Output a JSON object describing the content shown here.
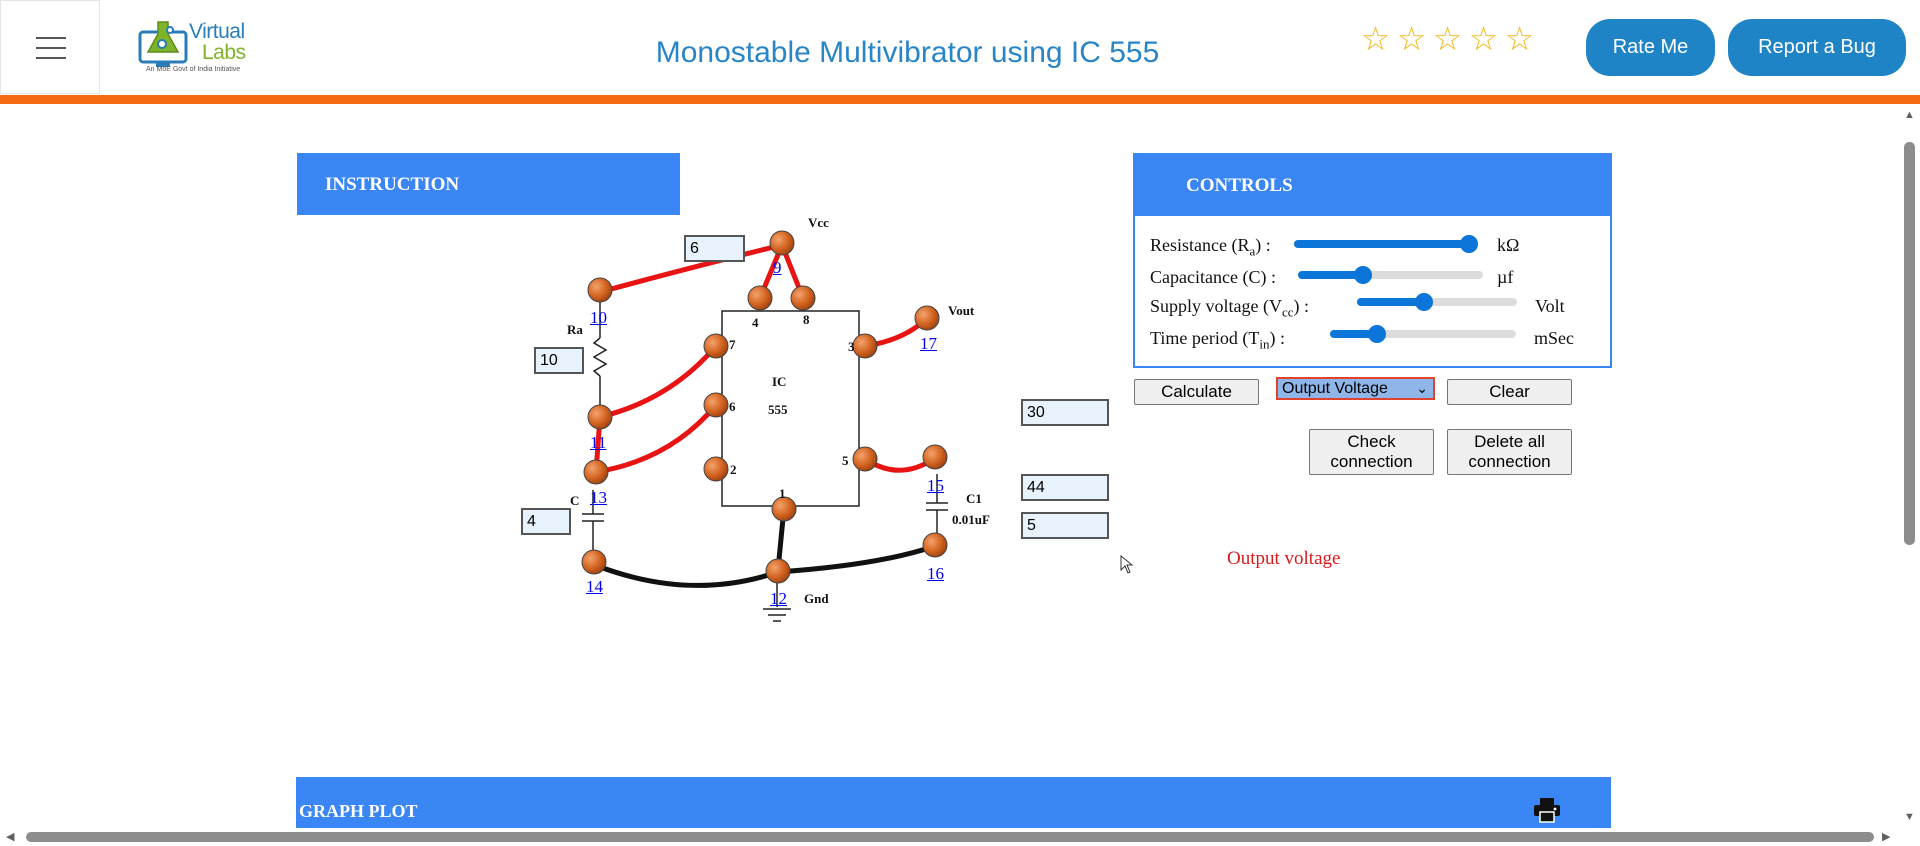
{
  "header": {
    "title": "Monostable Multivibrator using IC 555",
    "logo_line1": "Virtual",
    "logo_line2": "Labs",
    "logo_tagline": "An MoE Govt of India Initiative",
    "rating_stars": 5,
    "rate_button": "Rate Me",
    "bug_button": "Report a Bug",
    "accent_color": "#f36c12",
    "brand_color": "#1f84c6"
  },
  "instruction": {
    "heading": "INSTRUCTION"
  },
  "controls": {
    "heading": "CONTROLS",
    "resistance": {
      "label": "Resistance (R",
      "sub": "a",
      "tail": ") :",
      "unit": "kΩ",
      "level": 0.95
    },
    "capacitance": {
      "label": "Capacitance (C) :",
      "unit": "µf",
      "level": 0.35
    },
    "supply": {
      "label": "Supply voltage (V",
      "sub": "cc",
      "tail": ") :",
      "unit": "Volt",
      "level": 0.42
    },
    "period": {
      "label": "Time period (T",
      "sub": "in",
      "tail": ") :",
      "unit": "mSec",
      "level": 0.25
    },
    "calculate": "Calculate",
    "mode_selected": "Output Voltage",
    "clear": "Clear",
    "check1": "Check",
    "check2": "connection",
    "delete1": "Delete all",
    "delete2": "connection",
    "output_label": "Output voltage"
  },
  "circuit": {
    "vcc_value": "6",
    "ra_value": "10",
    "c_value": "4",
    "out1": "30",
    "out2": "44",
    "out3": "5",
    "vcc_label": "Vcc",
    "vout_label": "Vout",
    "ra_label": "Ra",
    "c_label": "C",
    "c1_label": "C1",
    "c1_value": "0.01uF",
    "gnd_label": "Gnd",
    "ic_name": "IC",
    "ic_number": "555",
    "ic_pins": [
      "4",
      "8",
      "7",
      "6",
      "2",
      "3",
      "5",
      "1"
    ],
    "nodes": [
      "9",
      "10",
      "11",
      "13",
      "14",
      "12",
      "15",
      "16",
      "17"
    ]
  },
  "graph": {
    "heading": "GRAPH PLOT",
    "print_icon": "printer-icon"
  }
}
